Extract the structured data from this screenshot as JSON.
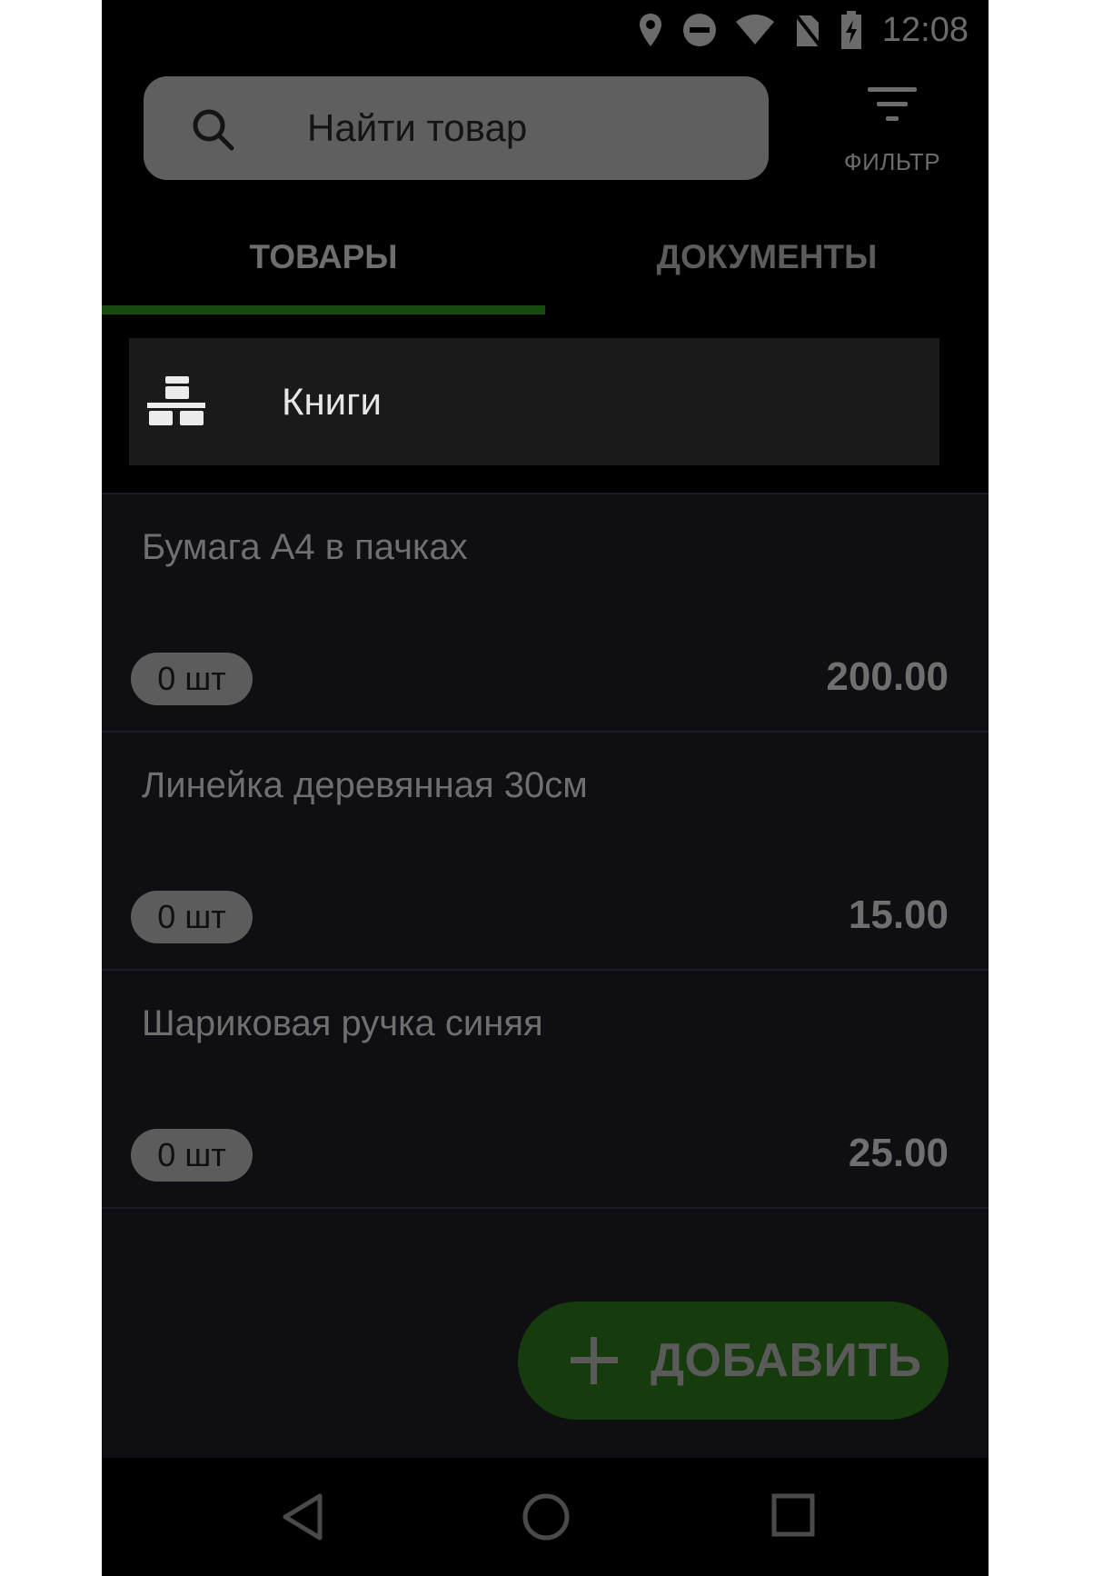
{
  "status_bar": {
    "time": "12:08",
    "icons": [
      "location-icon",
      "dnd-icon",
      "wifi-icon",
      "no-sim-icon",
      "battery-charging-icon"
    ]
  },
  "search": {
    "placeholder": "Найти товар",
    "icon": "search-icon"
  },
  "filter": {
    "label": "ФИЛЬТР",
    "icon": "filter-icon"
  },
  "tabs": [
    {
      "label": "ТОВАРЫ",
      "active": true
    },
    {
      "label": "ДОКУМЕНТЫ",
      "active": false
    }
  ],
  "category": {
    "label": "Книги",
    "icon": "category-boxes-icon"
  },
  "items": [
    {
      "name": "Бумага А4 в пачках",
      "qty": "0 шт",
      "price": "200.00"
    },
    {
      "name": "Линейка деревянная 30см",
      "qty": "0 шт",
      "price": "15.00"
    },
    {
      "name": "Шариковая ручка синяя",
      "qty": "0 шт",
      "price": "25.00"
    }
  ],
  "fab": {
    "label": "ДОБАВИТЬ",
    "icon": "plus-icon"
  },
  "nav": {
    "icons": [
      "back-icon",
      "home-icon",
      "recents-icon"
    ]
  },
  "colors": {
    "accent": "#174a0e",
    "fab_background": "#163b0c",
    "background": "#000000",
    "list_background": "#0f0f13"
  }
}
